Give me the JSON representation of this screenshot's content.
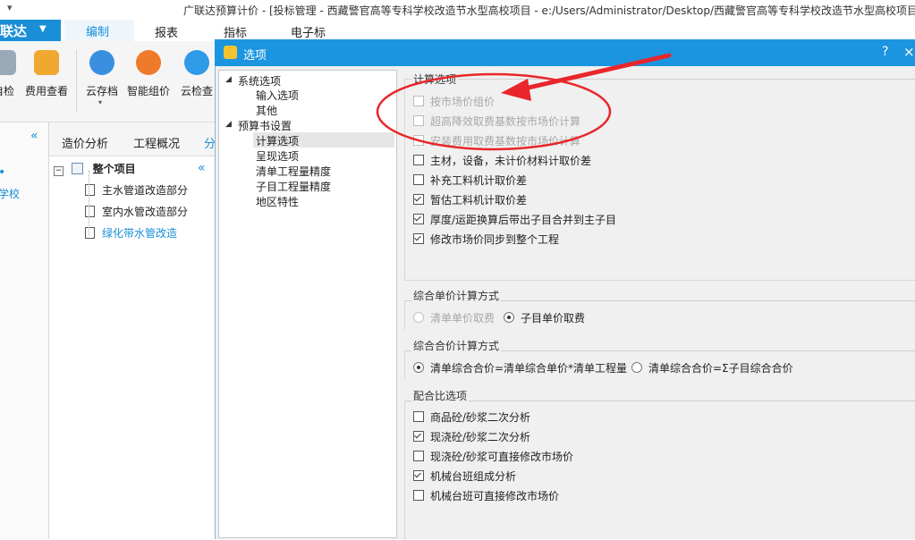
{
  "app": {
    "title": "广联达预算计价 - [投标管理 - 西藏警官高等专科学校改造节水型高校项目 - e:/Users/Administrator/Desktop/西藏警官高等专科学校改造节水型高校项目",
    "brand": "联达",
    "menu_tabs": [
      "编制",
      "报表",
      "指标",
      "电子标"
    ]
  },
  "ribbon": {
    "buttons": [
      {
        "label": "自检",
        "icon": "self-check-icon"
      },
      {
        "label": "费用查看",
        "icon": "cost-view-icon"
      },
      {
        "label": "云存档",
        "icon": "cloud-archive-icon"
      },
      {
        "label": "智能组价",
        "icon": "smart-pricing-icon"
      },
      {
        "label": "云检查",
        "icon": "cloud-check-icon"
      }
    ]
  },
  "left": {
    "nav_text": "学校",
    "tabs": [
      "造价分析",
      "工程概况",
      "分"
    ],
    "tree": {
      "root": "整个项目",
      "children": [
        "主水管道改造部分",
        "室内水管改造部分",
        "绿化带水管改造"
      ]
    }
  },
  "dialog": {
    "title": "选项",
    "help": "?",
    "close": "×",
    "nav": {
      "system_group": "系统选项",
      "system_items": [
        "输入选项",
        "其他"
      ],
      "budget_group": "预算书设置",
      "budget_items": [
        "计算选项",
        "呈现选项",
        "清单工程量精度",
        "子目工程量精度",
        "地区特性"
      ]
    },
    "calc": {
      "title": "计算选项",
      "options": [
        {
          "label": "按市场价组价",
          "checked": false,
          "disabled": true
        },
        {
          "label": "超高降效取费基数按市场价计算",
          "checked": false,
          "disabled": true
        },
        {
          "label": "安装费用取费基数按市场价计算",
          "checked": false,
          "disabled": true
        },
        {
          "label": "主材，设备，未计价材料计取价差",
          "checked": false,
          "disabled": false
        },
        {
          "label": "补充工料机计取价差",
          "checked": false,
          "disabled": false
        },
        {
          "label": "暂估工料机计取价差",
          "checked": true,
          "disabled": false
        },
        {
          "label": "厚度/运距换算后带出子目合并到主子目",
          "checked": true,
          "disabled": false
        },
        {
          "label": "修改市场价同步到整个工程",
          "checked": true,
          "disabled": false
        }
      ]
    },
    "unit_price": {
      "title": "综合单价计算方式",
      "options": [
        {
          "label": "清单单价取费",
          "selected": false,
          "disabled": true
        },
        {
          "label": "子目单价取费",
          "selected": true,
          "disabled": false
        }
      ]
    },
    "total_price": {
      "title": "综合合价计算方式",
      "options": [
        {
          "label": "清单综合合价=清单综合单价*清单工程量",
          "selected": true,
          "disabled": false
        },
        {
          "label": "清单综合合价=Σ子目综合合价",
          "selected": false,
          "disabled": false
        }
      ]
    },
    "mix": {
      "title": "配合比选项",
      "options": [
        {
          "label": "商品砼/砂浆二次分析",
          "checked": false
        },
        {
          "label": "现浇砼/砂浆二次分析",
          "checked": true
        },
        {
          "label": "现浇砼/砂浆可直接修改市场价",
          "checked": false
        },
        {
          "label": "机械台班组成分析",
          "checked": true
        },
        {
          "label": "机械台班可直接修改市场价",
          "checked": false
        }
      ]
    }
  },
  "colors": {
    "accent": "#1b95e0",
    "annotation": "#e8262b"
  }
}
